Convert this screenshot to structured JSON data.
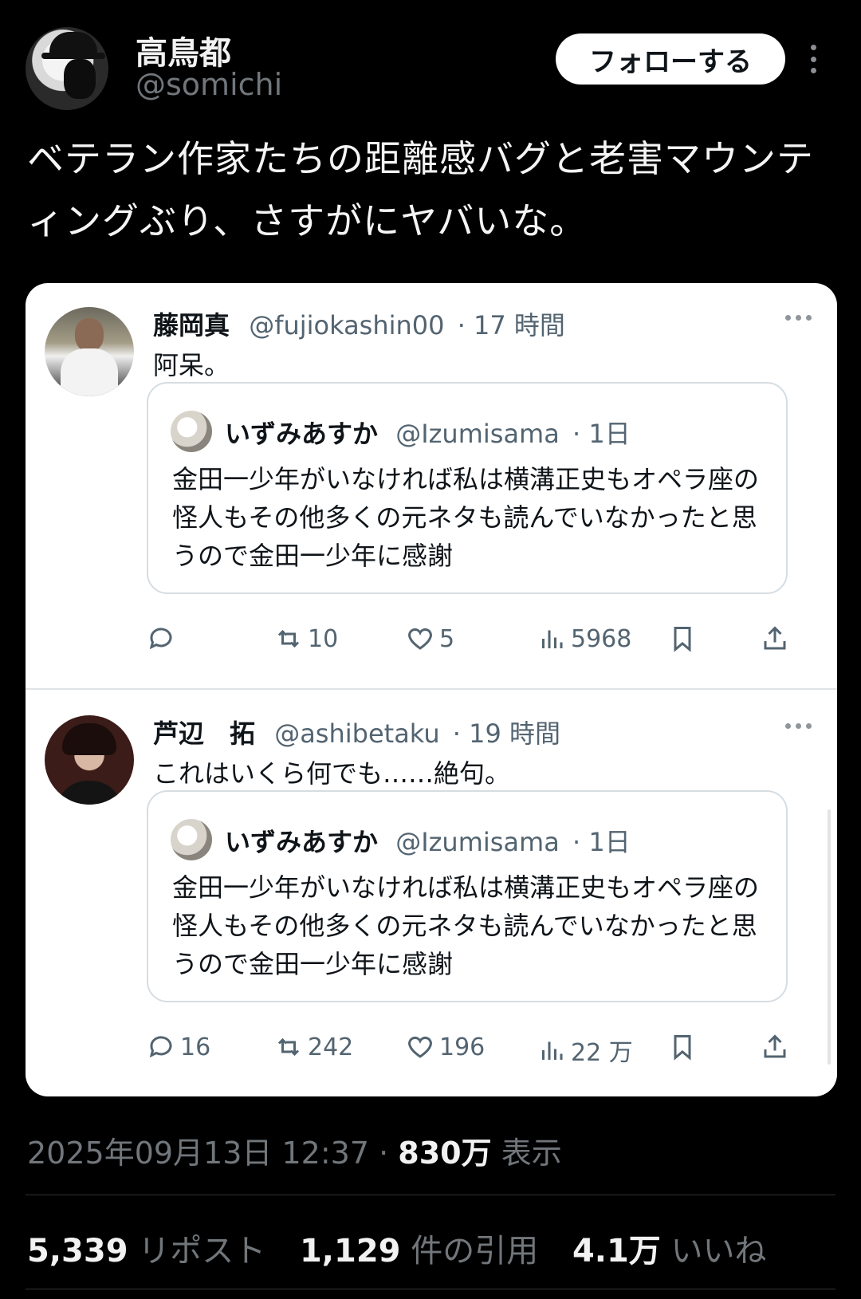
{
  "author": {
    "name": "高鳥都",
    "handle": "@somichi",
    "follow_label": "フォローする"
  },
  "tweet": {
    "text": "ベテラン作家たちの距離感バグと老害マウンティングぶり、さすがにヤバいな。"
  },
  "embedded_replies": [
    {
      "name": "藤岡真",
      "handle": "@fujiokashin00",
      "time": "· 17 時間",
      "text": "阿呆。",
      "quote": {
        "name": "いずみあすか",
        "handle": "@Izumisama",
        "time": "· 1日",
        "text": "金田一少年がいなければ私は横溝正史もオペラ座の怪人もその他多くの元ネタも読んでいなかったと思うので金田一少年に感謝"
      },
      "actions": {
        "replies": "",
        "reposts": "10",
        "likes": "5",
        "views": "5968"
      }
    },
    {
      "name": "芦辺　拓",
      "handle": "@ashibetaku",
      "time": "· 19 時間",
      "text": "これはいくら何でも……絶句。",
      "quote": {
        "name": "いずみあすか",
        "handle": "@Izumisama",
        "time": "· 1日",
        "text": "金田一少年がいなければ私は横溝正史もオペラ座の怪人もその他多くの元ネタも読んでいなかったと思うので金田一少年に感謝"
      },
      "actions": {
        "replies": "16",
        "reposts": "242",
        "likes": "196",
        "views": "22 万"
      }
    }
  ],
  "meta": {
    "timestamp": "2025年09月13日 12:37 ·",
    "views_count": "830万",
    "views_label": "表示"
  },
  "stats": {
    "reposts_count": "5,339",
    "reposts_label": "リポスト",
    "quotes_count": "1,129",
    "quotes_label": "件の引用",
    "likes_count": "4.1万",
    "likes_label": "いいね"
  },
  "colors": {
    "background": "#000000",
    "card": "#ffffff",
    "muted": "#71767b"
  }
}
